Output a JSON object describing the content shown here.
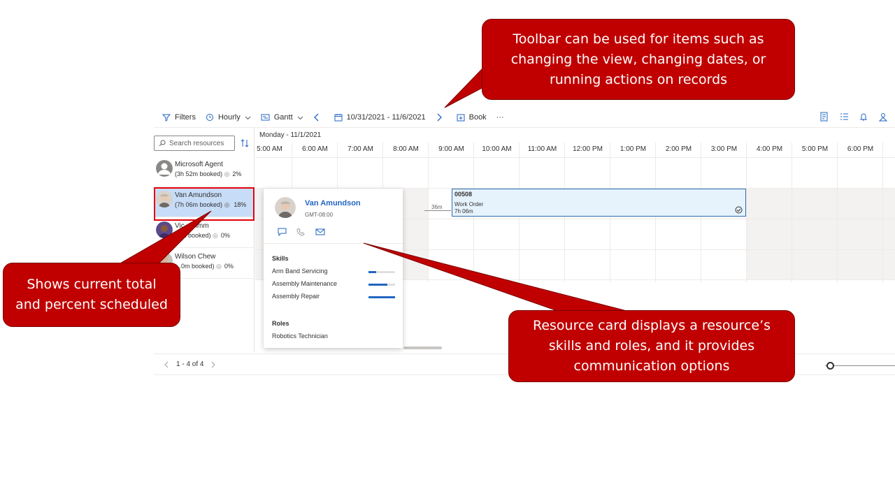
{
  "toolbar": {
    "filters": "Filters",
    "hourly": "Hourly",
    "gantt": "Gantt",
    "date_range": "10/31/2021 - 11/6/2021",
    "book": "Book",
    "more": "···"
  },
  "search": {
    "placeholder": "Search resources"
  },
  "resources": [
    {
      "name": "Microsoft Agent",
      "booked": "(3h 52m booked)",
      "pct": "2%"
    },
    {
      "name": "Van Amundson",
      "booked": "(7h 06m booked)",
      "pct": "18%"
    },
    {
      "name": "Vic… rimm",
      "booked": "…m booked)",
      "pct": "0%"
    },
    {
      "name": "Wilson Chew",
      "booked": "…0m booked)",
      "pct": "0%"
    }
  ],
  "timeline": {
    "date": "Monday - 11/1/2021",
    "hours": [
      "5:00 AM",
      "6:00 AM",
      "7:00 AM",
      "8:00 AM",
      "9:00 AM",
      "10:00 AM",
      "11:00 AM",
      "12:00 PM",
      "1:00 PM",
      "2:00 PM",
      "3:00 PM",
      "4:00 PM",
      "5:00 PM",
      "6:00 PM",
      "7"
    ]
  },
  "booking": {
    "id": "00508",
    "type": "Work Order",
    "duration": "7h 06m",
    "travel": "36m"
  },
  "card": {
    "name": "Van Amundson",
    "timezone": "GMT-08:00",
    "skills_title": "Skills",
    "skills": [
      {
        "name": "Arm Band Servicing",
        "level": 0.3
      },
      {
        "name": "Assembly Maintenance",
        "level": 0.7
      },
      {
        "name": "Assembly Repair",
        "level": 1.0
      }
    ],
    "roles_title": "Roles",
    "role": "Robotics Technician"
  },
  "footer": {
    "pager": "1 - 4 of 4"
  },
  "callouts": {
    "toolbar": "Toolbar can be used for items such as changing the view, changing dates, or running actions on records",
    "total": "Shows current total and percent scheduled",
    "card": "Resource card displays a resource’s skills and roles, and it provides communication options"
  },
  "colors": {
    "callout": "#c00000",
    "accent": "#2266c2",
    "selection": "#c7dcf7",
    "highlight_border": "#e3000b"
  }
}
